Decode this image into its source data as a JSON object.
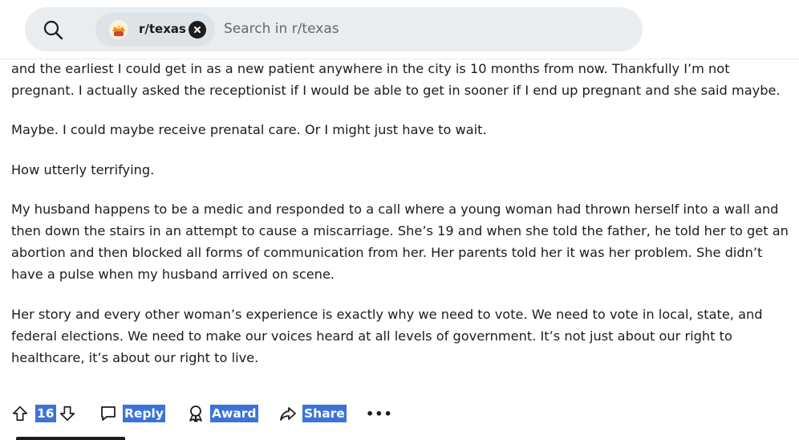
{
  "search": {
    "community_chip": "r/texas",
    "placeholder": "Search in r/texas"
  },
  "post": {
    "paragraphs": [
      "and the earliest I could get in as a new patient anywhere in the city is 10 months from now. Thankfully I’m not pregnant. I actually asked the receptionist if I would be able to get in sooner if I end up pregnant and she said maybe.",
      "Maybe. I could maybe receive prenatal care. Or I might just have to wait.",
      "How utterly terrifying.",
      "My husband happens to be a medic and responded to a call where a young woman had thrown herself into a wall and then down the stairs in an attempt to cause a miscarriage. She’s 19 and when she told the father, he told her to get an abortion and then blocked all forms of communication from her. Her parents told her it was her problem. She didn’t have a pulse when my husband arrived on scene.",
      "Her story and every other woman’s experience is exactly why we need to vote. We need to vote in local, state, and federal elections. We need to make our voices heard at all levels of government. It’s not just about our right to healthcare, it’s about our right to live."
    ]
  },
  "actions": {
    "vote_count": "16",
    "reply": "Reply",
    "award": "Award",
    "share": "Share",
    "more": "•••"
  },
  "colors": {
    "accent_highlight": "#3b73d9",
    "search_bg": "#eaedef",
    "chip_bg": "#dde3e7",
    "text": "#1c1c1c"
  }
}
